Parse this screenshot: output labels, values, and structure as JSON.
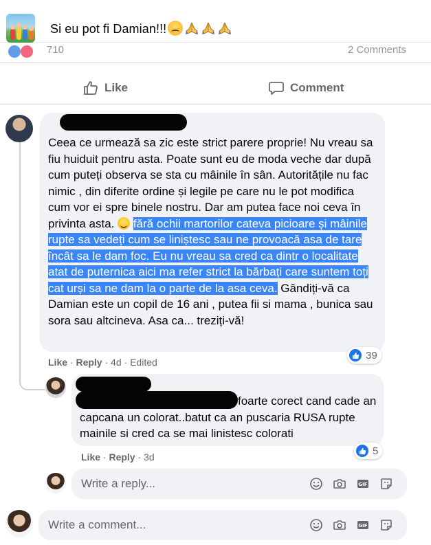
{
  "post": {
    "title": "Si eu pot fi Damian!!!",
    "faded_count": "710",
    "faded_comments": "2 Comments"
  },
  "actions": {
    "like": "Like",
    "comment": "Comment"
  },
  "comment1": {
    "text_1": "Ceea ce urmează sa zic este strict parere proprie! Nu vreau sa fiu huiduit pentru asta. Poate sunt eu de moda veche dar după cum puteți observa se sta cu mâinile în sân. Autoritățile nu fac nimic , din diferite ordine și legile pe care nu le pot modifica cum vor ei spre binele nostru. Dar am putea face noi ceva în privinta asta. ",
    "text_highlighted": "fără ochii martorilor cateva picioare și mâinile rupte sa vedeți cum se liniștesc sau ne provoacă asa de tare încât sa le dam foc. Eu nu vreau sa cred ca dintr o localitate atat de puternica aici ma refer strict la bărbați care suntem toți cat urși sa ne dam la o parte de la asa ceva.",
    "text_2": " Gândiți-vă ca Damian este un copil de 16 ani , putea fii si mama , bunica sau sora sau altcineva. Asa ca... treziți-vă!",
    "like": "Like",
    "reply": "Reply",
    "time": "4d",
    "edited": "Edited",
    "reactions": "39"
  },
  "comment2": {
    "text": "foarte corect cand cade an capcana un colorat..batut ca an puscaria RUSA rupte mainile si cred ca se mai linistesc colorati",
    "like": "Like",
    "reply": "Reply",
    "time": "3d",
    "reactions": "5"
  },
  "reply_input": {
    "placeholder": "Write a reply..."
  },
  "comment_input": {
    "placeholder": "Write a comment..."
  },
  "colors": {
    "facebook_blue": "#1b74e4",
    "highlight": "#3b86f7",
    "bubble": "#f0f2f5",
    "secondary_text": "#65676b"
  }
}
